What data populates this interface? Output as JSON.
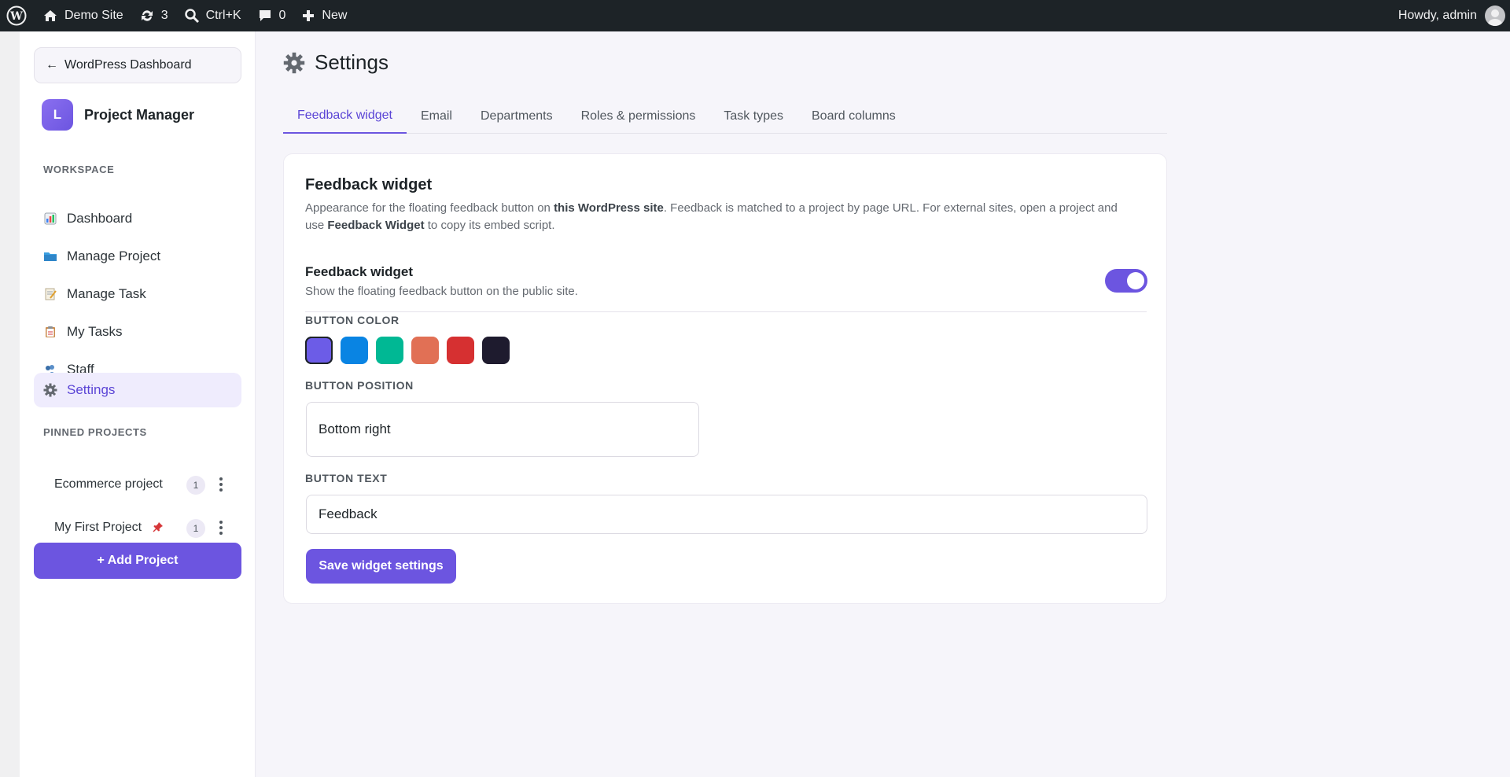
{
  "adminbar": {
    "site_name": "Demo Site",
    "updates_count": "3",
    "search_shortcut": "Ctrl+K",
    "comments_count": "0",
    "new_label": "New",
    "greeting": "Howdy, admin"
  },
  "sidebar": {
    "back_label": "WordPress Dashboard",
    "brand_initial": "L",
    "brand_name": "Project Manager",
    "workspace_label": "WORKSPACE",
    "items": [
      {
        "label": "Dashboard",
        "icon": "chart-icon"
      },
      {
        "label": "Manage Project",
        "icon": "folder-icon"
      },
      {
        "label": "Manage Task",
        "icon": "memo-icon"
      },
      {
        "label": "My Tasks",
        "icon": "clipboard-icon"
      },
      {
        "label": "Staff",
        "icon": "people-icon"
      },
      {
        "label": "Settings",
        "icon": "gear-icon"
      }
    ],
    "pinned_label": "PINNED PROJECTS",
    "pinned": [
      {
        "name": "Ecommerce project",
        "count": "1",
        "pinned_mark": false
      },
      {
        "name": "My First Project",
        "count": "1",
        "pinned_mark": true
      }
    ],
    "add_project_label": "+ Add Project"
  },
  "page": {
    "title": "Settings",
    "tabs": [
      "Feedback widget",
      "Email",
      "Departments",
      "Roles & permissions",
      "Task types",
      "Board columns"
    ]
  },
  "card": {
    "title": "Feedback widget",
    "desc_1": "Appearance for the floating feedback button on ",
    "desc_bold_1": "this WordPress site",
    "desc_2": ". Feedback is matched to a project by page URL. For external sites, open a project and use ",
    "desc_bold_2": "Feedback Widget",
    "desc_3": " to copy its embed script.",
    "toggle_title": "Feedback widget",
    "toggle_sub": "Show the floating feedback button on the public site.",
    "toggle_on": true,
    "color_label": "BUTTON COLOR",
    "colors": [
      "#6c5ce7",
      "#0984e3",
      "#00b894",
      "#e17055",
      "#d63031",
      "#1e1b2e"
    ],
    "selected_color": "#6c5ce7",
    "position_label": "BUTTON POSITION",
    "position_value": "Bottom right",
    "text_label": "BUTTON TEXT",
    "text_value": "Feedback",
    "save_label": "Save widget settings"
  },
  "colors": {
    "accent": "#6c55e0",
    "adminbar": "#1d2327"
  }
}
